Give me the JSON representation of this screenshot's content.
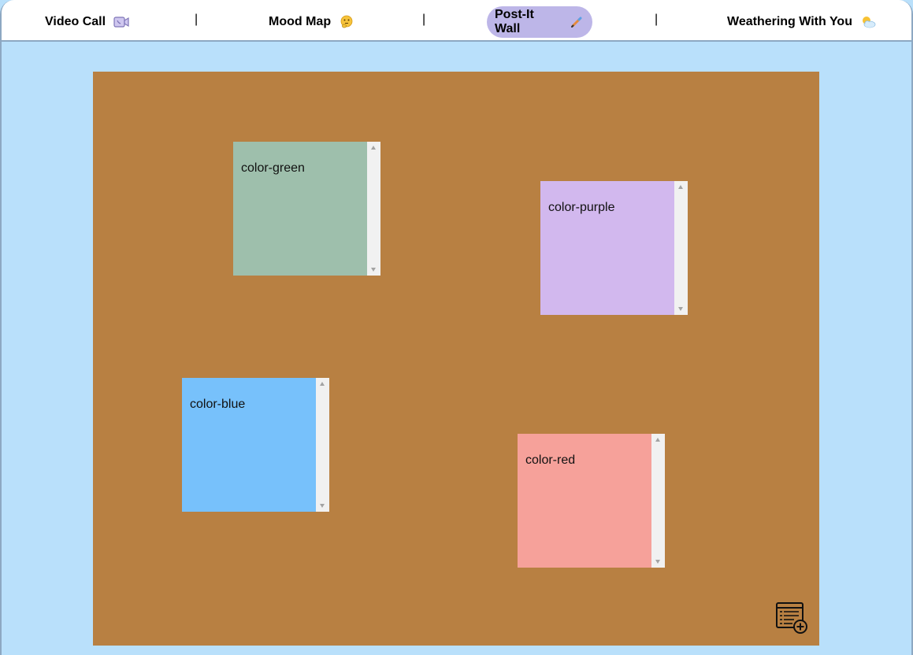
{
  "nav": {
    "items": [
      {
        "label": "Video Call",
        "icon": "video-camera-icon"
      },
      {
        "label": "Mood Map",
        "icon": "thinking-face-icon"
      },
      {
        "label": "Post-It Wall",
        "icon": "pencil-icon",
        "active": true
      },
      {
        "label": "Weathering With You",
        "icon": "sun-behind-cloud-icon"
      }
    ],
    "separator": "|"
  },
  "board": {
    "color": "#b88042",
    "notes": [
      {
        "text": "color-green",
        "color": "#9ebfac"
      },
      {
        "text": "color-purple",
        "color": "#d2b8ee"
      },
      {
        "text": "color-blue",
        "color": "#77c1fb"
      },
      {
        "text": "color-red",
        "color": "#f6a19a"
      }
    ],
    "add_note_icon": "add-note-icon"
  },
  "colors": {
    "background": "#b9e0fb",
    "nav_active": "#bdb6e8",
    "border": "#8da8c2"
  }
}
